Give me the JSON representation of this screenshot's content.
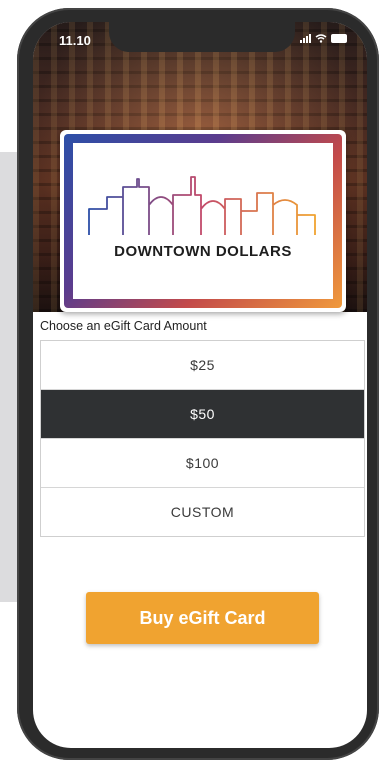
{
  "status": {
    "time": "11.10"
  },
  "card": {
    "brand_text": "DOWNTOWN DOLLARS"
  },
  "amount_picker": {
    "label": "Choose an eGift Card Amount",
    "options": [
      "$25",
      "$50",
      "$100",
      "CUSTOM"
    ],
    "selected": "$50"
  },
  "buy_button": {
    "label": "Buy eGift Card"
  },
  "colors": {
    "accent": "#f0a330",
    "selected_option_bg": "#2f3133",
    "card_gradient": [
      "#2c4fa8",
      "#5a3c8e",
      "#c34a4a",
      "#f09a3c"
    ]
  },
  "icons": [
    "signal-icon",
    "wifi-icon",
    "battery-icon",
    "skyline-logo-icon"
  ]
}
